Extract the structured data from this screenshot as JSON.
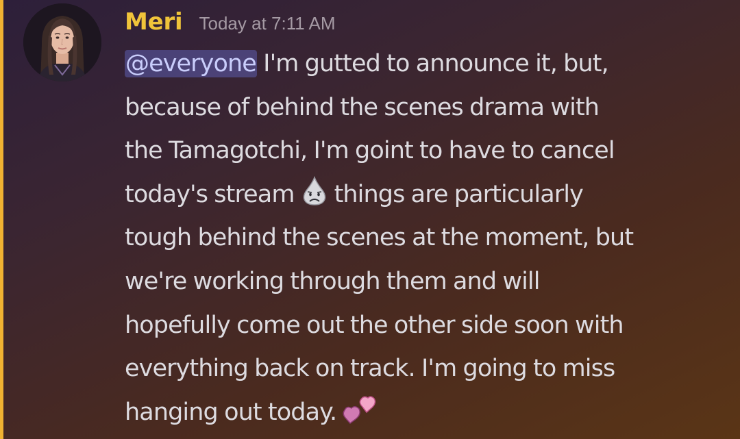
{
  "message": {
    "author": {
      "name": "Meri",
      "name_color": "#f0c43a"
    },
    "timestamp": "Today at 7:11 AM",
    "mention": "@everyone",
    "lines": [
      " I'm gutted to announce it, but,",
      "because of behind the scenes drama with",
      "the Tamagotchi, I'm goint to have to cancel",
      "today's stream",
      "things are particularly",
      "tough behind the scenes at the moment, but",
      "we're working through them and will",
      "hopefully come out the other side soon with",
      "everything back on track. I'm going to miss",
      "hanging out today."
    ],
    "emojis": {
      "sad": "disappointed-relieved-face",
      "hearts": "two-hearts"
    }
  },
  "colors": {
    "mention_bar": "#f0b232",
    "mention_bg": "#6e76e6",
    "text": "#dddbe0",
    "timestamp": "#a59aa4"
  }
}
